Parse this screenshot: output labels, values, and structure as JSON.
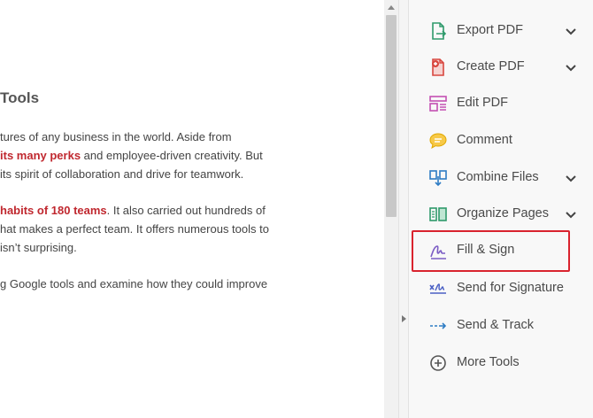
{
  "document": {
    "heading": "Tools",
    "lines": [
      {
        "before": "tures of any business in the world. Aside from",
        "highlight": "",
        "after": ""
      },
      {
        "before": "",
        "highlight": "its many perks",
        "after": " and employee-driven creativity. But"
      },
      {
        "before": "its spirit of collaboration and drive for teamwork.",
        "highlight": "",
        "after": ""
      },
      {
        "before": "",
        "highlight": "habits of 180 teams",
        "after": ". It also carried out hundreds of"
      },
      {
        "before": "hat makes a perfect team. It offers numerous tools to",
        "highlight": "",
        "after": ""
      },
      {
        "before": "isn’t surprising.",
        "highlight": "",
        "after": ""
      },
      {
        "before": "g Google tools and examine how they could improve",
        "highlight": "",
        "after": ""
      }
    ]
  },
  "tools": [
    {
      "label": "Export PDF",
      "icon": "export-pdf-icon",
      "has_menu": true
    },
    {
      "label": "Create PDF",
      "icon": "create-pdf-icon",
      "has_menu": true
    },
    {
      "label": "Edit PDF",
      "icon": "edit-pdf-icon",
      "has_menu": false
    },
    {
      "label": "Comment",
      "icon": "comment-icon",
      "has_menu": false
    },
    {
      "label": "Combine Files",
      "icon": "combine-files-icon",
      "has_menu": true
    },
    {
      "label": "Organize Pages",
      "icon": "organize-pages-icon",
      "has_menu": true
    },
    {
      "label": "Fill & Sign",
      "icon": "fill-sign-icon",
      "has_menu": false,
      "highlighted": true
    },
    {
      "label": "Send for Signature",
      "icon": "send-signature-icon",
      "has_menu": false
    },
    {
      "label": "Send & Track",
      "icon": "send-track-icon",
      "has_menu": false
    },
    {
      "label": "More Tools",
      "icon": "more-tools-icon",
      "has_menu": false
    }
  ],
  "colors": {
    "highlight_text": "#c0282f",
    "highlight_box": "#d9232e"
  }
}
